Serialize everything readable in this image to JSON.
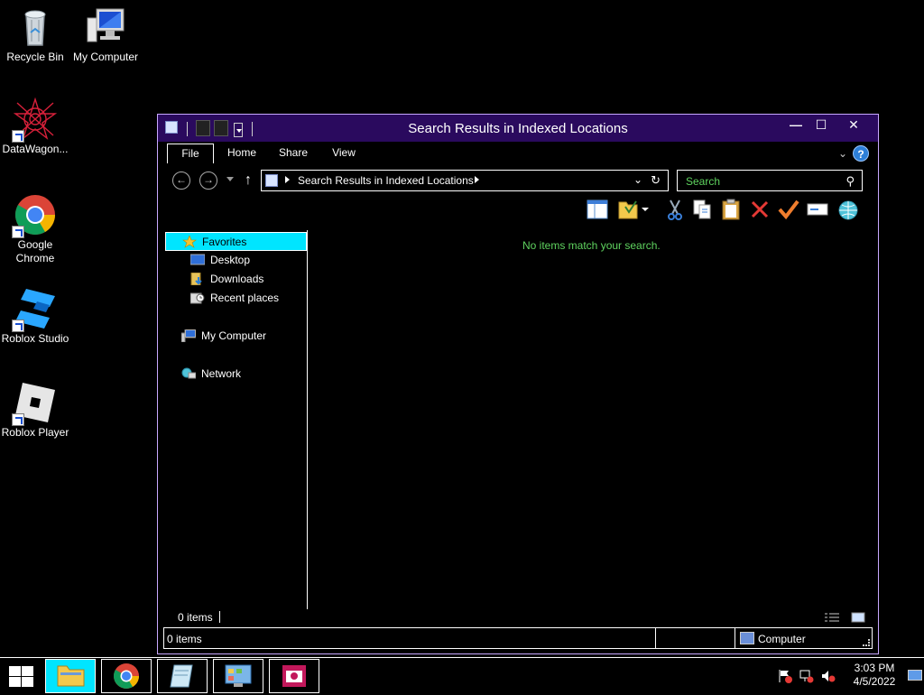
{
  "desktop": {
    "icons": [
      {
        "label": "Recycle Bin"
      },
      {
        "label": "My Computer"
      },
      {
        "label": "DataWagon..."
      },
      {
        "label": "Google Chrome"
      },
      {
        "label": "Roblox Studio"
      },
      {
        "label": "Roblox Player"
      }
    ]
  },
  "window": {
    "title": "Search Results in Indexed Locations",
    "controls": {
      "minimize": "—",
      "maximize": "☐",
      "close": "✕"
    },
    "ribbon_tabs": [
      {
        "label": "File",
        "active": true
      },
      {
        "label": "Home"
      },
      {
        "label": "Share"
      },
      {
        "label": "View"
      }
    ],
    "address": {
      "path": "Search Results in Indexed Locations"
    },
    "search": {
      "placeholder": "Search"
    },
    "nav_pane": {
      "favorites": "Favorites",
      "desktop": "Desktop",
      "downloads": "Downloads",
      "recent": "Recent places",
      "computer": "My Computer",
      "network": "Network"
    },
    "empty_message": "No items match your search.",
    "item_count": "0 items",
    "status_bar": {
      "left": "0 items",
      "location": "Computer"
    }
  },
  "taskbar": {
    "clock": {
      "time": "3:03 PM",
      "date": "4/5/2022"
    }
  },
  "colors": {
    "titlebar": "#2a0a5e",
    "selection": "#00e5ff",
    "message_green": "#5fd35f"
  }
}
